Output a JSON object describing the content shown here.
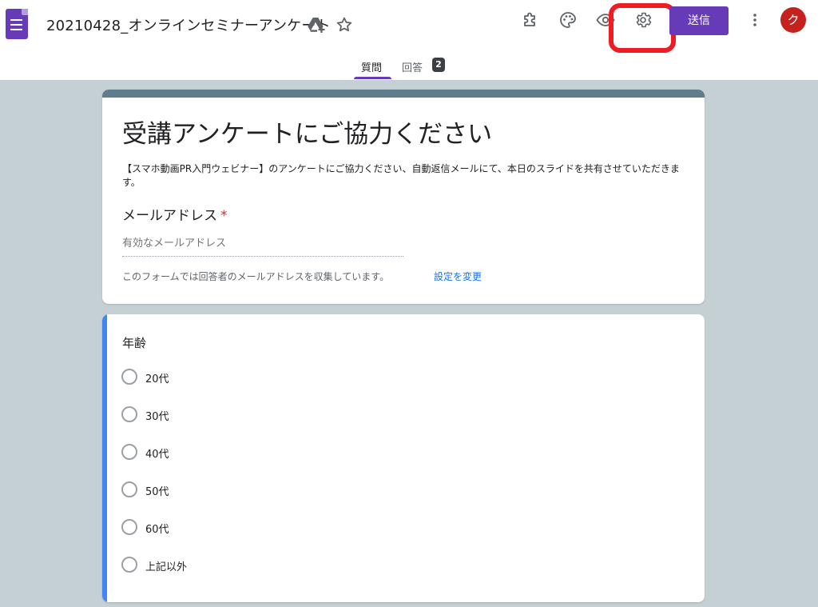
{
  "header": {
    "title": "20210428_オンラインセミナーアンケート",
    "send_label": "送信",
    "avatar_initial": "ク",
    "icons": [
      "forms-logo-icon",
      "drive-add-icon",
      "star-icon",
      "addon-icon",
      "palette-icon",
      "preview-eye-icon",
      "settings-gear-icon",
      "more-vert-icon"
    ]
  },
  "tabs": {
    "questions_label": "質問",
    "responses_label": "回答",
    "responses_count": "2"
  },
  "form": {
    "title": "受講アンケートにご協力ください",
    "description": "【スマホ動画PR入門ウェビナー】のアンケートにご協力ください、自動返信メールにて、本日のスライドを共有させていただきます。",
    "email_label": "メールアドレス",
    "required_mark": "*",
    "email_placeholder": "有効なメールアドレス",
    "collect_note": "このフォームでは回答者のメールアドレスを収集しています。",
    "change_settings_link": "設定を変更"
  },
  "question": {
    "title": "年齢",
    "options": [
      "20代",
      "30代",
      "40代",
      "50代",
      "60代",
      "上記以外"
    ]
  },
  "colors": {
    "brand": "#673ab7",
    "header_accent": "#5f7d8c",
    "question_accent": "#4285f4",
    "highlight": "#ee1d23",
    "background": "#c5d0d4",
    "avatar": "#c5221f"
  }
}
